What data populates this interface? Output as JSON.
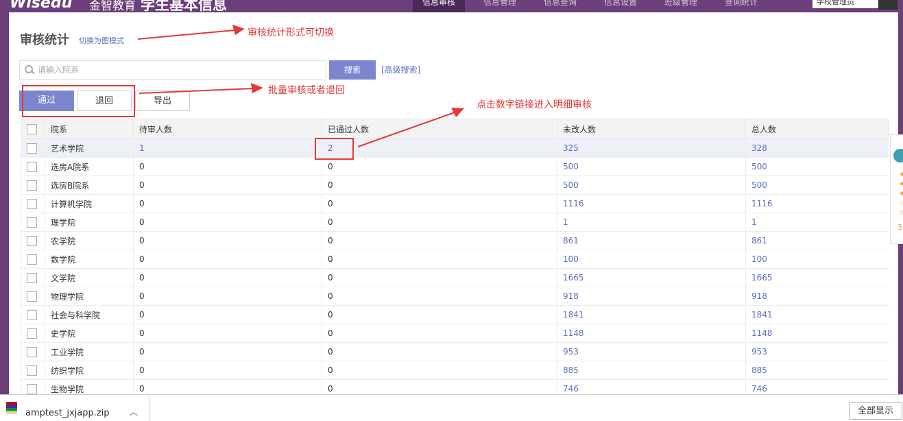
{
  "header": {
    "logo": "Wisedu",
    "logo_cn": "金智教育",
    "app_title": "学生基本信息",
    "nav": [
      "信息审核",
      "信息管理",
      "信息查询",
      "信息设置",
      "班级管理",
      "查询统计"
    ],
    "user": "学校管理员"
  },
  "page": {
    "title": "审核统计",
    "switch_link": "切换为图模式"
  },
  "search": {
    "placeholder": "请输入院系",
    "button": "搜索",
    "advanced": "[高级搜索]"
  },
  "actions": {
    "pass": "通过",
    "back": "退回",
    "export": "导出"
  },
  "table": {
    "columns": [
      "院系",
      "待审人数",
      "已通过人数",
      "未改人数",
      "总人数"
    ],
    "rows": [
      {
        "dept": "艺术学院",
        "pending": "1",
        "passed": "2",
        "unchanged": "325",
        "total": "328"
      },
      {
        "dept": "选房A院系",
        "pending": "0",
        "passed": "0",
        "unchanged": "500",
        "total": "500"
      },
      {
        "dept": "选房B院系",
        "pending": "0",
        "passed": "0",
        "unchanged": "500",
        "total": "500"
      },
      {
        "dept": "计算机学院",
        "pending": "0",
        "passed": "0",
        "unchanged": "1116",
        "total": "1116"
      },
      {
        "dept": "理学院",
        "pending": "0",
        "passed": "0",
        "unchanged": "1",
        "total": "1"
      },
      {
        "dept": "农学院",
        "pending": "0",
        "passed": "0",
        "unchanged": "861",
        "total": "861"
      },
      {
        "dept": "数学院",
        "pending": "0",
        "passed": "0",
        "unchanged": "100",
        "total": "100"
      },
      {
        "dept": "文学院",
        "pending": "0",
        "passed": "0",
        "unchanged": "1665",
        "total": "1665"
      },
      {
        "dept": "物理学院",
        "pending": "0",
        "passed": "0",
        "unchanged": "918",
        "total": "918"
      },
      {
        "dept": "社会与科学院",
        "pending": "0",
        "passed": "0",
        "unchanged": "1841",
        "total": "1841"
      },
      {
        "dept": "史学院",
        "pending": "0",
        "passed": "0",
        "unchanged": "1148",
        "total": "1148"
      },
      {
        "dept": "工业学院",
        "pending": "0",
        "passed": "0",
        "unchanged": "953",
        "total": "953"
      },
      {
        "dept": "纺织学院",
        "pending": "0",
        "passed": "0",
        "unchanged": "885",
        "total": "885"
      },
      {
        "dept": "生物学院",
        "pending": "0",
        "passed": "0",
        "unchanged": "746",
        "total": "746"
      }
    ]
  },
  "annotations": {
    "switch_note": "审核统计形式可切换",
    "batch_note": "批量审核或者退回",
    "drill_note": "点击数字链接进入明细审核"
  },
  "sidewidget": {
    "score": "3."
  },
  "download": {
    "filename": "amptest_jxjapp.zip",
    "show_all": "全部显示"
  },
  "colors": {
    "brand": "#6b3f7a",
    "accent": "#7b86cf",
    "link": "#5b6ec2",
    "annotation": "#e23838"
  }
}
